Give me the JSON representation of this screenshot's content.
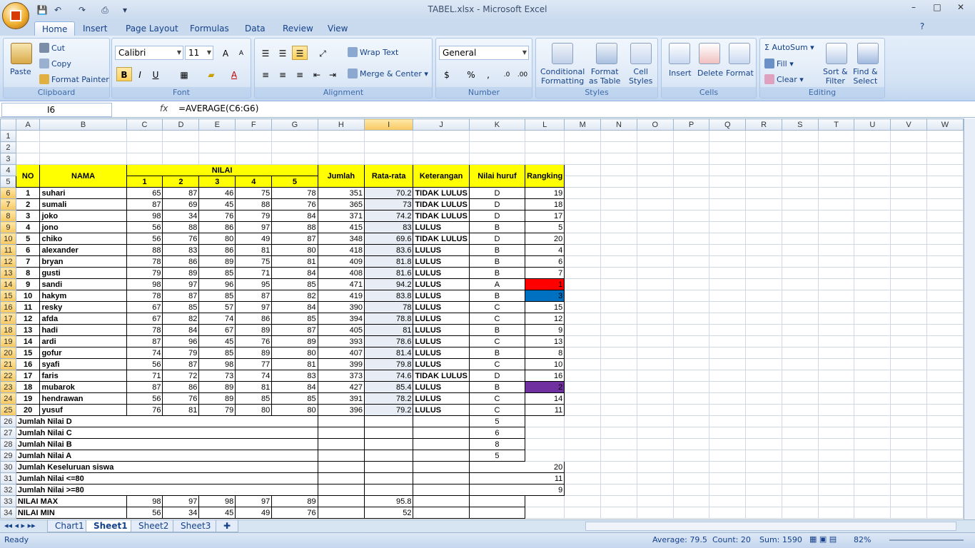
{
  "window": {
    "title": "TABEL.xlsx - Microsoft Excel",
    "min": "–",
    "max": "□",
    "close": "✕"
  },
  "tabs": [
    "Home",
    "Insert",
    "Page Layout",
    "Formulas",
    "Data",
    "Review",
    "View"
  ],
  "clipboard": {
    "paste": "Paste",
    "cut": "Cut",
    "copy": "Copy",
    "format_painter": "Format Painter",
    "title": "Clipboard"
  },
  "font": {
    "name": "Calibri",
    "size": "11",
    "title": "Font",
    "bold": "B",
    "italic": "I",
    "underline": "U"
  },
  "alignment": {
    "wrap": "Wrap Text",
    "merge": "Merge & Center",
    "title": "Alignment"
  },
  "number": {
    "format": "General",
    "title": "Number",
    "currency": "$",
    "percent": "%",
    "comma": ","
  },
  "styles": {
    "cond1": "Conditional",
    "cond2": "Formatting",
    "fmt1": "Format",
    "fmt2": "as Table",
    "cell1": "Cell",
    "cell2": "Styles",
    "title": "Styles"
  },
  "cells": {
    "insert": "Insert",
    "delete": "Delete",
    "format": "Format",
    "title": "Cells"
  },
  "editing": {
    "autosum": "AutoSum",
    "fill": "Fill",
    "clear": "Clear",
    "sort1": "Sort &",
    "sort2": "Filter",
    "find1": "Find &",
    "find2": "Select",
    "title": "Editing"
  },
  "formula_bar": {
    "name_box": "I6",
    "fx": "fx",
    "formula": "=AVERAGE(C6:G6)"
  },
  "columns": [
    "A",
    "B",
    "C",
    "D",
    "E",
    "F",
    "G",
    "H",
    "I",
    "J",
    "K",
    "L",
    "M",
    "N",
    "O",
    "P",
    "Q",
    "R",
    "S",
    "T",
    "U",
    "V",
    "W"
  ],
  "header": {
    "no": "NO",
    "nama": "NAMA",
    "nilai": "NILAI",
    "n1": "1",
    "n2": "2",
    "n3": "3",
    "n4": "4",
    "n5": "5",
    "jumlah": "Jumlah",
    "rata": "Rata-rata",
    "ket": "Keterangan",
    "huruf": "Nilai huruf",
    "rank": "Rangking"
  },
  "students": [
    [
      "1",
      "suhari",
      "65",
      "87",
      "46",
      "75",
      "78",
      "351",
      "70.2",
      "TIDAK LULUS",
      "D",
      "19"
    ],
    [
      "2",
      "sumali",
      "87",
      "69",
      "45",
      "88",
      "76",
      "365",
      "73",
      "TIDAK LULUS",
      "D",
      "18"
    ],
    [
      "3",
      "joko",
      "98",
      "34",
      "76",
      "79",
      "84",
      "371",
      "74.2",
      "TIDAK LULUS",
      "D",
      "17"
    ],
    [
      "4",
      "jono",
      "56",
      "88",
      "86",
      "97",
      "88",
      "415",
      "83",
      "LULUS",
      "B",
      "5"
    ],
    [
      "5",
      "chiko",
      "56",
      "76",
      "80",
      "49",
      "87",
      "348",
      "69.6",
      "TIDAK LULUS",
      "D",
      "20"
    ],
    [
      "6",
      "alexander",
      "88",
      "83",
      "86",
      "81",
      "80",
      "418",
      "83.6",
      "LULUS",
      "B",
      "4"
    ],
    [
      "7",
      "bryan",
      "78",
      "86",
      "89",
      "75",
      "81",
      "409",
      "81.8",
      "LULUS",
      "B",
      "6"
    ],
    [
      "8",
      "gusti",
      "79",
      "89",
      "85",
      "71",
      "84",
      "408",
      "81.6",
      "LULUS",
      "B",
      "7"
    ],
    [
      "9",
      "sandi",
      "98",
      "97",
      "96",
      "95",
      "85",
      "471",
      "94.2",
      "LULUS",
      "A",
      "1"
    ],
    [
      "10",
      "hakym",
      "78",
      "87",
      "85",
      "87",
      "82",
      "419",
      "83.8",
      "LULUS",
      "B",
      "3"
    ],
    [
      "11",
      "resky",
      "67",
      "85",
      "57",
      "97",
      "84",
      "390",
      "78",
      "LULUS",
      "C",
      "15"
    ],
    [
      "12",
      "afda",
      "67",
      "82",
      "74",
      "86",
      "85",
      "394",
      "78.8",
      "LULUS",
      "C",
      "12"
    ],
    [
      "13",
      "hadi",
      "78",
      "84",
      "67",
      "89",
      "87",
      "405",
      "81",
      "LULUS",
      "B",
      "9"
    ],
    [
      "14",
      "ardi",
      "87",
      "96",
      "45",
      "76",
      "89",
      "393",
      "78.6",
      "LULUS",
      "C",
      "13"
    ],
    [
      "15",
      "gofur",
      "74",
      "79",
      "85",
      "89",
      "80",
      "407",
      "81.4",
      "LULUS",
      "B",
      "8"
    ],
    [
      "16",
      "syafi",
      "56",
      "87",
      "98",
      "77",
      "81",
      "399",
      "79.8",
      "LULUS",
      "C",
      "10"
    ],
    [
      "17",
      "faris",
      "71",
      "72",
      "73",
      "74",
      "83",
      "373",
      "74.6",
      "TIDAK LULUS",
      "D",
      "16"
    ],
    [
      "18",
      "mubarok",
      "87",
      "86",
      "89",
      "81",
      "84",
      "427",
      "85.4",
      "LULUS",
      "B",
      "2"
    ],
    [
      "19",
      "hendrawan",
      "56",
      "76",
      "89",
      "85",
      "85",
      "391",
      "78.2",
      "LULUS",
      "C",
      "14"
    ],
    [
      "20",
      "yusuf",
      "76",
      "81",
      "79",
      "80",
      "80",
      "396",
      "79.2",
      "LULUS",
      "C",
      "11"
    ]
  ],
  "summary": [
    {
      "label": "Jumlah Nilai D",
      "k": "5"
    },
    {
      "label": "Jumlah Nilai C",
      "k": "6"
    },
    {
      "label": "Jumlah Nilai B",
      "k": "8"
    },
    {
      "label": "Jumlah Nilai A",
      "k": "5"
    },
    {
      "label": "Jumlah Keseluruan siswa",
      "kr": "20"
    },
    {
      "label": "Jumlah Nilai <=80",
      "kr": "11"
    },
    {
      "label": "Jumlah Nilai >=80",
      "kr": "9"
    }
  ],
  "max": {
    "label": "NILAI MAX",
    "vals": [
      "98",
      "97",
      "98",
      "97",
      "89"
    ],
    "avg": "95.8"
  },
  "min": {
    "label": "NILAI MIN",
    "vals": [
      "56",
      "34",
      "45",
      "49",
      "76"
    ],
    "avg": "52"
  },
  "sheets": [
    "Chart1",
    "Sheet1",
    "Sheet2",
    "Sheet3"
  ],
  "status": {
    "ready": "Ready",
    "average": "Average: 79.5",
    "count": "Count: 20",
    "sum": "Sum: 1590",
    "zoom": "82%"
  },
  "colors": {
    "rank1": "#ff0000",
    "rank2": "#7030a0",
    "rank3": "#0070c0",
    "header": "#ffff00"
  }
}
